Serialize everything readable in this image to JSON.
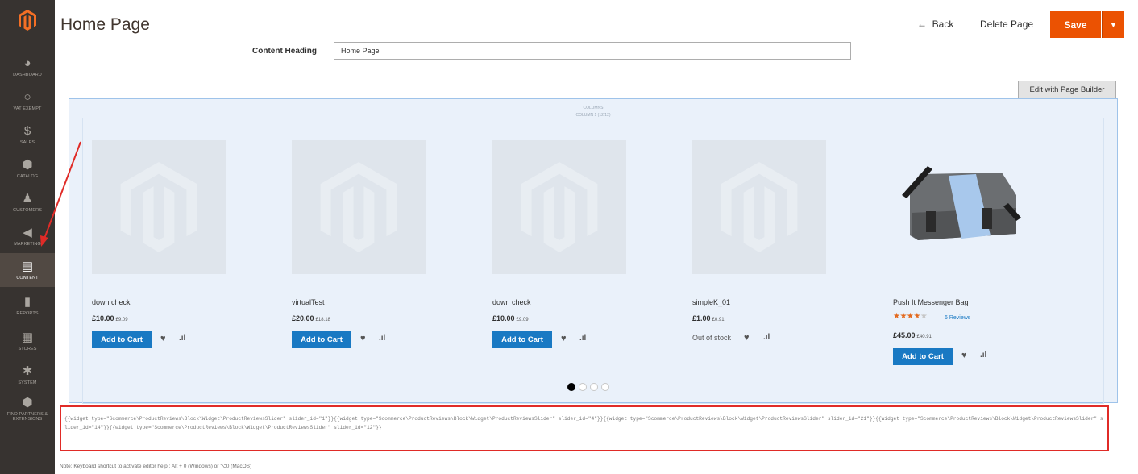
{
  "sidebar": {
    "items": [
      {
        "label": "Dashboard",
        "icon": "dashboard-icon",
        "glyph": "◕"
      },
      {
        "label": "VAT Exempt",
        "icon": "circle-icon",
        "glyph": "○"
      },
      {
        "label": "Sales",
        "icon": "dollar-icon",
        "glyph": "$"
      },
      {
        "label": "Catalog",
        "icon": "cube-icon",
        "glyph": "⬢"
      },
      {
        "label": "Customers",
        "icon": "person-icon",
        "glyph": "♟"
      },
      {
        "label": "Marketing",
        "icon": "megaphone-icon",
        "glyph": "◀"
      },
      {
        "label": "Content",
        "icon": "layout-icon",
        "glyph": "▤"
      },
      {
        "label": "Reports",
        "icon": "bar-chart-icon",
        "glyph": "▮"
      },
      {
        "label": "Stores",
        "icon": "store-icon",
        "glyph": "▦"
      },
      {
        "label": "System",
        "icon": "gear-icon",
        "glyph": "✱"
      },
      {
        "label": "Find Partners & Extensions",
        "icon": "cube-icon",
        "glyph": "⬢"
      }
    ],
    "active": "Content"
  },
  "header": {
    "title": "Home Page",
    "back_label": "Back",
    "delete_label": "Delete Page",
    "save_label": "Save"
  },
  "form": {
    "content_heading_label": "Content Heading",
    "content_heading_value": "Home Page",
    "page_builder_button": "Edit with Page Builder"
  },
  "stage": {
    "column_group_label": "COLUMNS",
    "column_label": "COLUMN 1 (12/12)"
  },
  "products": [
    {
      "name": "down check",
      "price": "£10.00",
      "price_excl": "£9.09",
      "action": "Add to Cart"
    },
    {
      "name": "virtualTest",
      "price": "£20.00",
      "price_excl": "£18.18",
      "action": "Add to Cart"
    },
    {
      "name": "down check",
      "price": "£10.00",
      "price_excl": "£9.09",
      "action": "Add to Cart"
    },
    {
      "name": "simpleK_01",
      "price": "£1.00",
      "price_excl": "£0.91",
      "stock": "Out of stock"
    },
    {
      "name": "Push It Messenger Bag",
      "rating": 4,
      "reviews": "6 Reviews",
      "price": "£45.00",
      "price_excl": "£40.91",
      "action": "Add to Cart"
    }
  ],
  "carousel": {
    "pages": 4,
    "current": 1
  },
  "widget_code": "{{widget type=\"Scommerce\\ProductReviews\\Block\\Widget\\ProductReviewsSlider\" slider_id=\"1\"}}{{widget type=\"Scommerce\\ProductReviews\\Block\\Widget\\ProductReviewsSlider\" slider_id=\"4\"}}{{widget type=\"Scommerce\\ProductReviews\\Block\\Widget\\ProductReviewsSlider\" slider_id=\"21\"}}{{widget type=\"Scommerce\\ProductReviews\\Block\\Widget\\ProductReviewsSlider\" slider_id=\"14\"}}{{widget type=\"Scommerce\\ProductReviews\\Block\\Widget\\ProductReviewsSlider\" slider_id=\"12\"}}",
  "note": "Note: Keyboard shortcut to activate editor help : Alt + 0 (Windows) or ⌥0 (MacOS)",
  "colors": {
    "accent": "#eb5202",
    "sidebar": "#373330",
    "button_blue": "#1979c3",
    "highlight_red": "#e02b27"
  }
}
